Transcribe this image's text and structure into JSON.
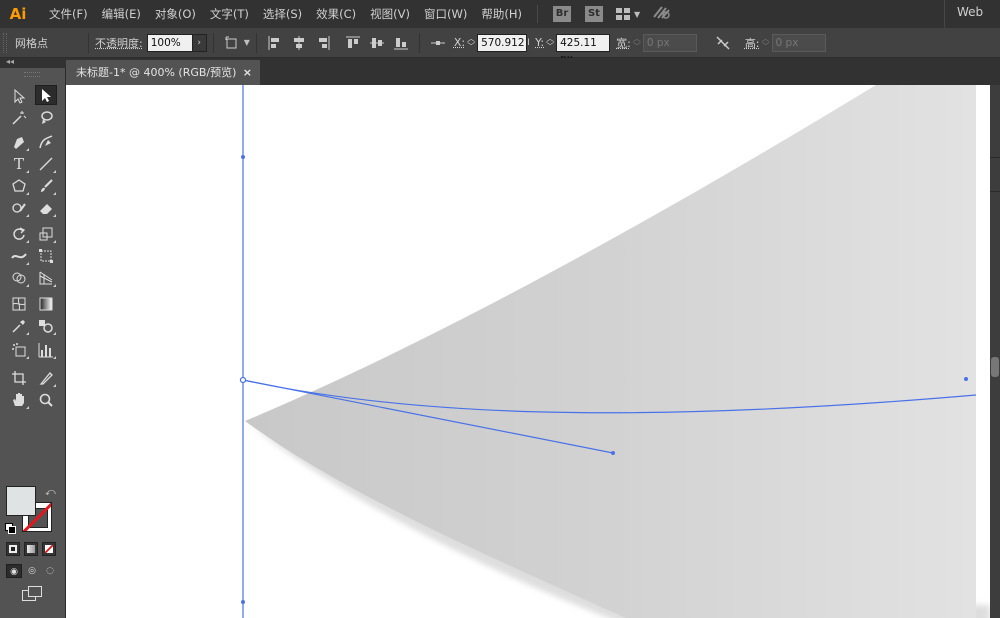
{
  "app": {
    "logo": "Ai",
    "workspace": "Web"
  },
  "menubar": {
    "items": [
      {
        "label": "文件(F)"
      },
      {
        "label": "编辑(E)"
      },
      {
        "label": "对象(O)"
      },
      {
        "label": "文字(T)"
      },
      {
        "label": "选择(S)"
      },
      {
        "label": "效果(C)"
      },
      {
        "label": "视图(V)"
      },
      {
        "label": "窗口(W)"
      },
      {
        "label": "帮助(H)"
      }
    ],
    "bridge": "Br",
    "stock": "St"
  },
  "control": {
    "selection_label": "网格点",
    "opacity_label": "不透明度:",
    "opacity_value": "100%",
    "x_label": "X:",
    "x_value": "570.912",
    "y_label": "Y:",
    "y_value": "425.11 px",
    "w_label": "宽:",
    "w_value": "0 px",
    "h_label": "高:",
    "h_value": "0 px"
  },
  "document": {
    "tab_title": "未标题-1* @ 400% (RGB/预览)",
    "close": "×"
  },
  "tools": [
    {
      "name": "selection-tool-icon"
    },
    {
      "name": "direct-selection-tool-icon",
      "active": true
    },
    {
      "name": "magic-wand-tool-icon"
    },
    {
      "name": "lasso-tool-icon"
    },
    {
      "name": "pen-tool-icon"
    },
    {
      "name": "curvature-tool-icon"
    },
    {
      "name": "type-tool-icon"
    },
    {
      "name": "line-segment-tool-icon"
    },
    {
      "name": "polygon-tool-icon"
    },
    {
      "name": "paintbrush-tool-icon"
    },
    {
      "name": "shaper-tool-icon"
    },
    {
      "name": "eraser-tool-icon"
    },
    {
      "name": "rotate-tool-icon"
    },
    {
      "name": "scale-tool-icon"
    },
    {
      "name": "width-tool-icon"
    },
    {
      "name": "free-transform-tool-icon"
    },
    {
      "name": "shape-builder-tool-icon"
    },
    {
      "name": "perspective-grid-tool-icon"
    },
    {
      "name": "mesh-tool-icon"
    },
    {
      "name": "gradient-tool-icon"
    },
    {
      "name": "eyedropper-tool-icon"
    },
    {
      "name": "blend-tool-icon"
    },
    {
      "name": "symbol-sprayer-tool-icon"
    },
    {
      "name": "column-graph-tool-icon"
    },
    {
      "name": "artboard-tool-icon"
    },
    {
      "name": "slice-tool-icon"
    },
    {
      "name": "hand-tool-icon"
    },
    {
      "name": "zoom-tool-icon"
    }
  ],
  "colors": {
    "fill": "#dfe3e3",
    "stroke": "none",
    "selection": "#4a72e8",
    "shape_light": "#dcdcdc",
    "shape_dark": "#c9c9c9",
    "accent": "#ff9a00"
  }
}
